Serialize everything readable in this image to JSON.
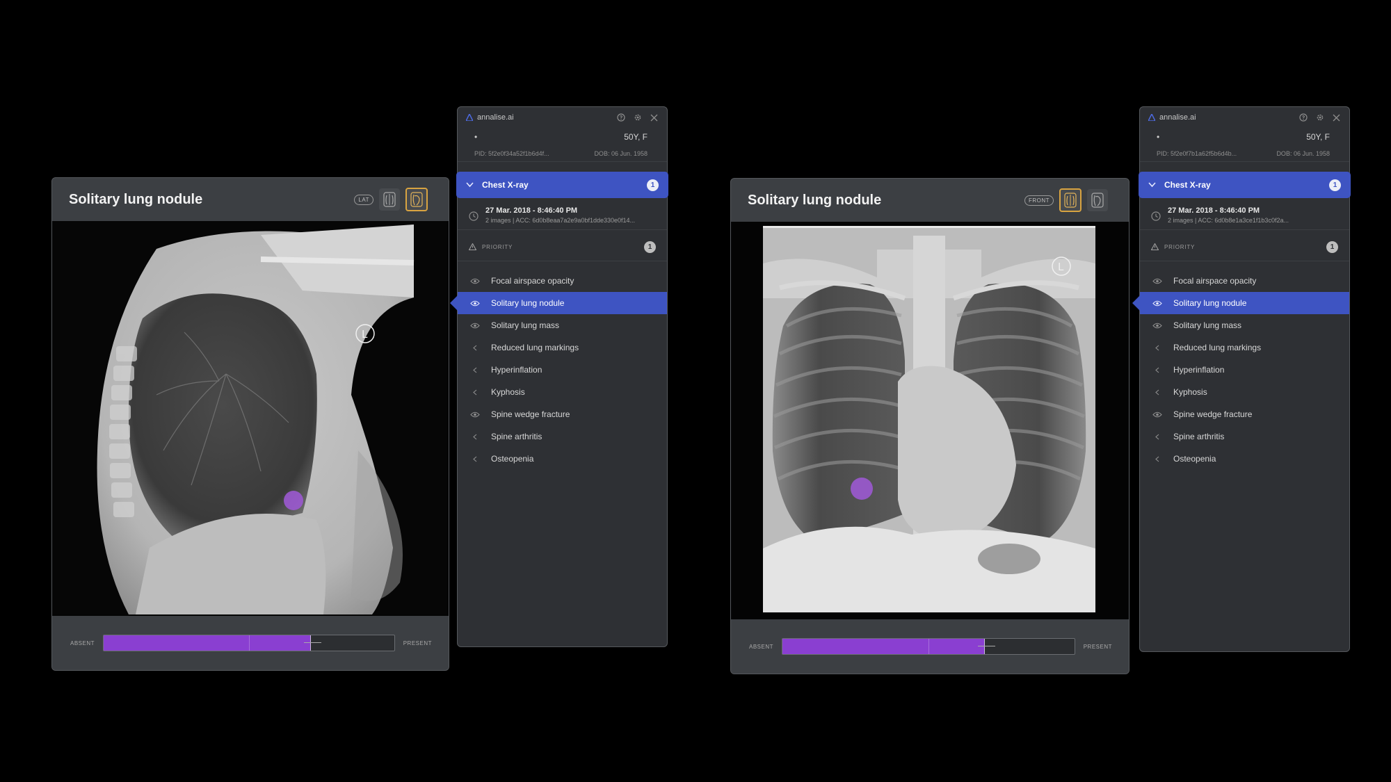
{
  "views": [
    {
      "title": "Solitary lung nodule",
      "view_tag": "LAT",
      "confidence": {
        "absent_label": "ABSENT",
        "present_label": "PRESENT",
        "value": 0.71
      },
      "panel": {
        "brand": "annalise.ai",
        "patient_dot": "•",
        "patient_age_sex": "50Y, F",
        "patient_id": "PID: 5f2e0f34a52f1b6d4f...",
        "dob": "DOB: 06 Jun. 1958",
        "study_title": "Chest X-ray",
        "study_count": "1",
        "series_date": "27 Mar. 2018 - 8:46:40 PM",
        "series_info": "2 images | ACC: 6d0b8eaa7a2e9a0bf1dde330e0f14...",
        "priority_label": "PRIORITY",
        "priority_count": "1",
        "findings": [
          "Focal airspace opacity",
          "Solitary lung nodule",
          "Solitary lung mass",
          "Reduced lung markings",
          "Hyperinflation",
          "Kyphosis",
          "Spine wedge fracture",
          "Spine arthritis",
          "Osteopenia"
        ]
      }
    },
    {
      "title": "Solitary lung nodule",
      "view_tag": "FRONT",
      "confidence": {
        "absent_label": "ABSENT",
        "present_label": "PRESENT",
        "value": 0.69
      },
      "panel": {
        "brand": "annalise.ai",
        "patient_dot": "•",
        "patient_age_sex": "50Y, F",
        "patient_id": "PID: 5f2e0f7b1a62f5b6d4b...",
        "dob": "DOB: 06 Jun. 1958",
        "study_title": "Chest X-ray",
        "study_count": "1",
        "series_date": "27 Mar. 2018 - 8:46:40 PM",
        "series_info": "2 images | ACC: 6d0b8e1a3ce1f1b3c0f2a...",
        "priority_label": "PRIORITY",
        "priority_count": "1",
        "findings": [
          "Focal airspace opacity",
          "Solitary lung nodule",
          "Solitary lung mass",
          "Reduced lung markings",
          "Hyperinflation",
          "Kyphosis",
          "Spine wedge fracture",
          "Spine arthritis",
          "Osteopenia"
        ]
      }
    }
  ],
  "colors": {
    "accent": "#3e54c2",
    "nodule_overlay": "#9b59d0",
    "confidence_fill": "#8a3fd1",
    "active_view_border": "#d9a441"
  },
  "icons": {
    "finding_visible": "eye-icon",
    "finding_hidden": "chevron-icon"
  }
}
